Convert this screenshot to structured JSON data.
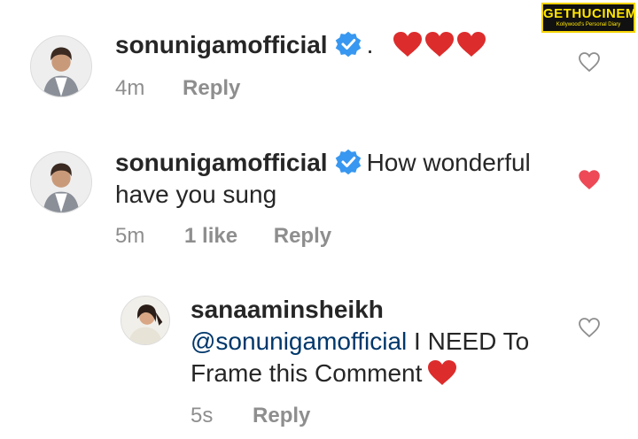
{
  "watermark": {
    "brand": "GETHUCINEMA",
    "tagline": "Kollywood's Personal Diary"
  },
  "comments": [
    {
      "username": "sonunigamofficial",
      "verified": true,
      "text": ".",
      "hearts": 3,
      "time": "4m",
      "likes": "",
      "reply_label": "Reply",
      "liked": false
    },
    {
      "username": "sonunigamofficial",
      "verified": true,
      "text_line1": "How wonderful",
      "text_line2": "have you sung",
      "time": "5m",
      "likes": "1 like",
      "reply_label": "Reply",
      "liked": true
    },
    {
      "username": "sanaaminsheikh",
      "verified": false,
      "mention": "@sonunigamofficial",
      "text_line1": "I NEED To",
      "text_line2": "Frame this Comment",
      "hearts": 1,
      "time": "5s",
      "likes": "",
      "reply_label": "Reply",
      "liked": false
    }
  ],
  "colors": {
    "heart": "#ed4956",
    "verified": "#3897f0",
    "meta": "#8e8e8e",
    "mention": "#00376b"
  },
  "icons": {
    "verified": "verified-badge-icon",
    "like": "heart-outline-icon",
    "liked": "heart-filled-icon"
  }
}
